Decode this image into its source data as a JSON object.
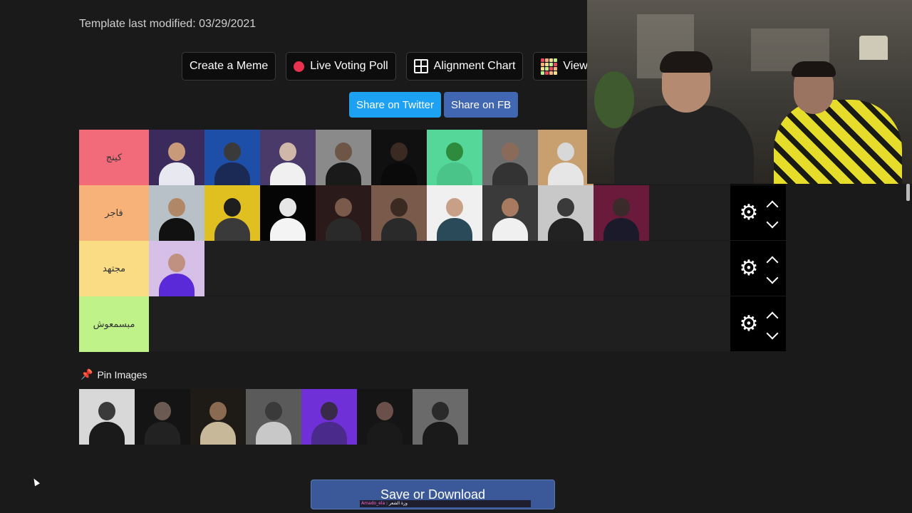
{
  "header": {
    "template_modified": "Template last modified: 03/29/2021"
  },
  "toolbar": {
    "create_meme": "Create a Meme",
    "live_voting": "Live Voting Poll",
    "alignment_chart": "Alignment Chart",
    "view": "View"
  },
  "share": {
    "twitter": "Share on Twitter",
    "facebook": "Share on FB"
  },
  "tiers": [
    {
      "label": "كينج",
      "color": "#f26b7a",
      "items": [
        {
          "bg": "#3b2a5c",
          "skin": "#c89a7a",
          "cloth": "#e8e8f0"
        },
        {
          "bg": "#1d4fa8",
          "skin": "#3a3a3a",
          "cloth": "#1b2a55"
        },
        {
          "bg": "#4a3a6a",
          "skin": "#d0b8a8",
          "cloth": "#f0f0f0"
        },
        {
          "bg": "#8a8a8a",
          "skin": "#6e5646",
          "cloth": "#1a1a1a"
        },
        {
          "bg": "#101010",
          "skin": "#3a2a22",
          "cloth": "#0a0a0a"
        },
        {
          "bg": "#55d79a",
          "skin": "#2e8a3c",
          "cloth": "#4bc48a"
        },
        {
          "bg": "#6e6e6e",
          "skin": "#8a6a58",
          "cloth": "#333"
        },
        {
          "bg": "#c8a070",
          "skin": "#d8d8d8",
          "cloth": "#e6e6e6"
        }
      ]
    },
    {
      "label": "فاجر",
      "color": "#f7b27a",
      "items": [
        {
          "bg": "#b8c0c8",
          "skin": "#b08868",
          "cloth": "#111"
        },
        {
          "bg": "#e0c020",
          "skin": "#1e1e1e",
          "cloth": "#3a3a3a"
        },
        {
          "bg": "#050505",
          "skin": "#e6e6e6",
          "cloth": "#f4f4f4"
        },
        {
          "bg": "#2a1a1a",
          "skin": "#7a5a4a",
          "cloth": "#2a2a2a"
        },
        {
          "bg": "#7a5a4a",
          "skin": "#3a2a22",
          "cloth": "#2a2a2a"
        },
        {
          "bg": "#f0f0f0",
          "skin": "#c8a088",
          "cloth": "#2a4a5a"
        },
        {
          "bg": "#3a3a3a",
          "skin": "#a87a60",
          "cloth": "#f0f0f0"
        },
        {
          "bg": "#c8c8c8",
          "skin": "#3a3a3a",
          "cloth": "#222"
        },
        {
          "bg": "#6a1a3a",
          "skin": "#3a2a2a",
          "cloth": "#1a1a2a"
        }
      ]
    },
    {
      "label": "مجتهد",
      "color": "#f9dc84",
      "items": [
        {
          "bg": "#d6c0e8",
          "skin": "#c09080",
          "cloth": "#5a2ad8"
        }
      ]
    },
    {
      "label": "مبسمعوش",
      "color": "#bff38a",
      "items": []
    }
  ],
  "pin": {
    "label": "Pin Images",
    "items": [
      {
        "bg": "#d8d8d8",
        "skin": "#3a3a3a",
        "cloth": "#1a1a1a"
      },
      {
        "bg": "#141414",
        "skin": "#6a5a52",
        "cloth": "#222"
      },
      {
        "bg": "#1e1a16",
        "skin": "#8a6a50",
        "cloth": "#c8b89a"
      },
      {
        "bg": "#5a5a5a",
        "skin": "#3a3a3a",
        "cloth": "#c8c8c8"
      },
      {
        "bg": "#7030d8",
        "skin": "#3a2a4a",
        "cloth": "#4a2a8a"
      },
      {
        "bg": "#151515",
        "skin": "#6a5048",
        "cloth": "#1a1a1a"
      },
      {
        "bg": "#6a6a6a",
        "skin": "#2a2a2a",
        "cloth": "#1a1a1a"
      }
    ]
  },
  "save": {
    "label": "Save or Download"
  },
  "chat": {
    "user": "Amado_ela",
    "message": " : وزة الشعر"
  },
  "colors": {
    "twitter": "#1da1f2",
    "facebook": "#4267b2",
    "save": "#3b5998"
  }
}
